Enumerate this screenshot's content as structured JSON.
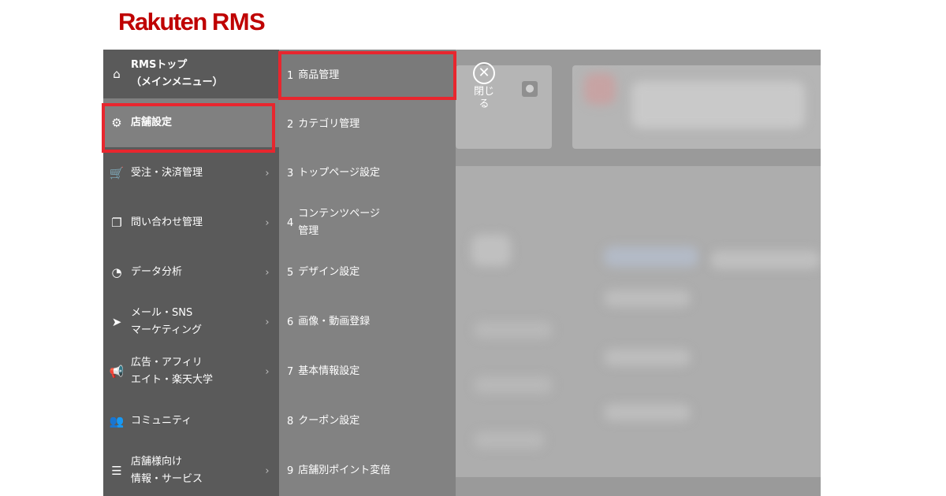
{
  "logo": {
    "brand": "Rakuten",
    "product": "RMS"
  },
  "header": {
    "close_label": "閉じる",
    "close_glyph": "✕",
    "bulb_glyph": "●"
  },
  "sidebar": {
    "items": [
      {
        "label": "RMSトップ\n（メインメニュー）",
        "icon": "home-icon",
        "glyph": "⌂"
      },
      {
        "label": "店舗設定",
        "icon": "gear-icon",
        "glyph": "⚙"
      },
      {
        "label": "受注・決済管理",
        "icon": "cart-icon",
        "glyph": "🛒",
        "chevron": "›"
      },
      {
        "label": "問い合わせ管理",
        "icon": "chat-icon",
        "glyph": "❐",
        "chevron": "›"
      },
      {
        "label": "データ分析",
        "icon": "pie-chart-icon",
        "glyph": "◔",
        "chevron": "›"
      },
      {
        "label": "メール・SNS\nマーケティング",
        "icon": "send-icon",
        "glyph": "➤",
        "chevron": "›"
      },
      {
        "label": "広告・アフィリ\nエイト・楽天大学",
        "icon": "megaphone-icon",
        "glyph": "📢",
        "chevron": "›"
      },
      {
        "label": "コミュニティ",
        "icon": "people-icon",
        "glyph": "👥"
      },
      {
        "label": "店舗様向け\n情報・サービス",
        "icon": "list-icon",
        "glyph": "☰",
        "chevron": "›"
      }
    ]
  },
  "submenu": {
    "items": [
      {
        "num": "1",
        "label": "商品管理"
      },
      {
        "num": "2",
        "label": "カテゴリ管理"
      },
      {
        "num": "3",
        "label": "トップページ設定"
      },
      {
        "num": "4",
        "label": "コンテンツページ\n管理"
      },
      {
        "num": "5",
        "label": "デザイン設定"
      },
      {
        "num": "6",
        "label": "画像・動画登録"
      },
      {
        "num": "7",
        "label": "基本情報設定"
      },
      {
        "num": "8",
        "label": "クーポン設定"
      },
      {
        "num": "9",
        "label": "店舗別ポイント変倍"
      }
    ]
  },
  "colors": {
    "highlight": "#e8262e",
    "brand": "#bf0000",
    "sidebar": "#5a5a5a",
    "submenu": "#828282"
  }
}
